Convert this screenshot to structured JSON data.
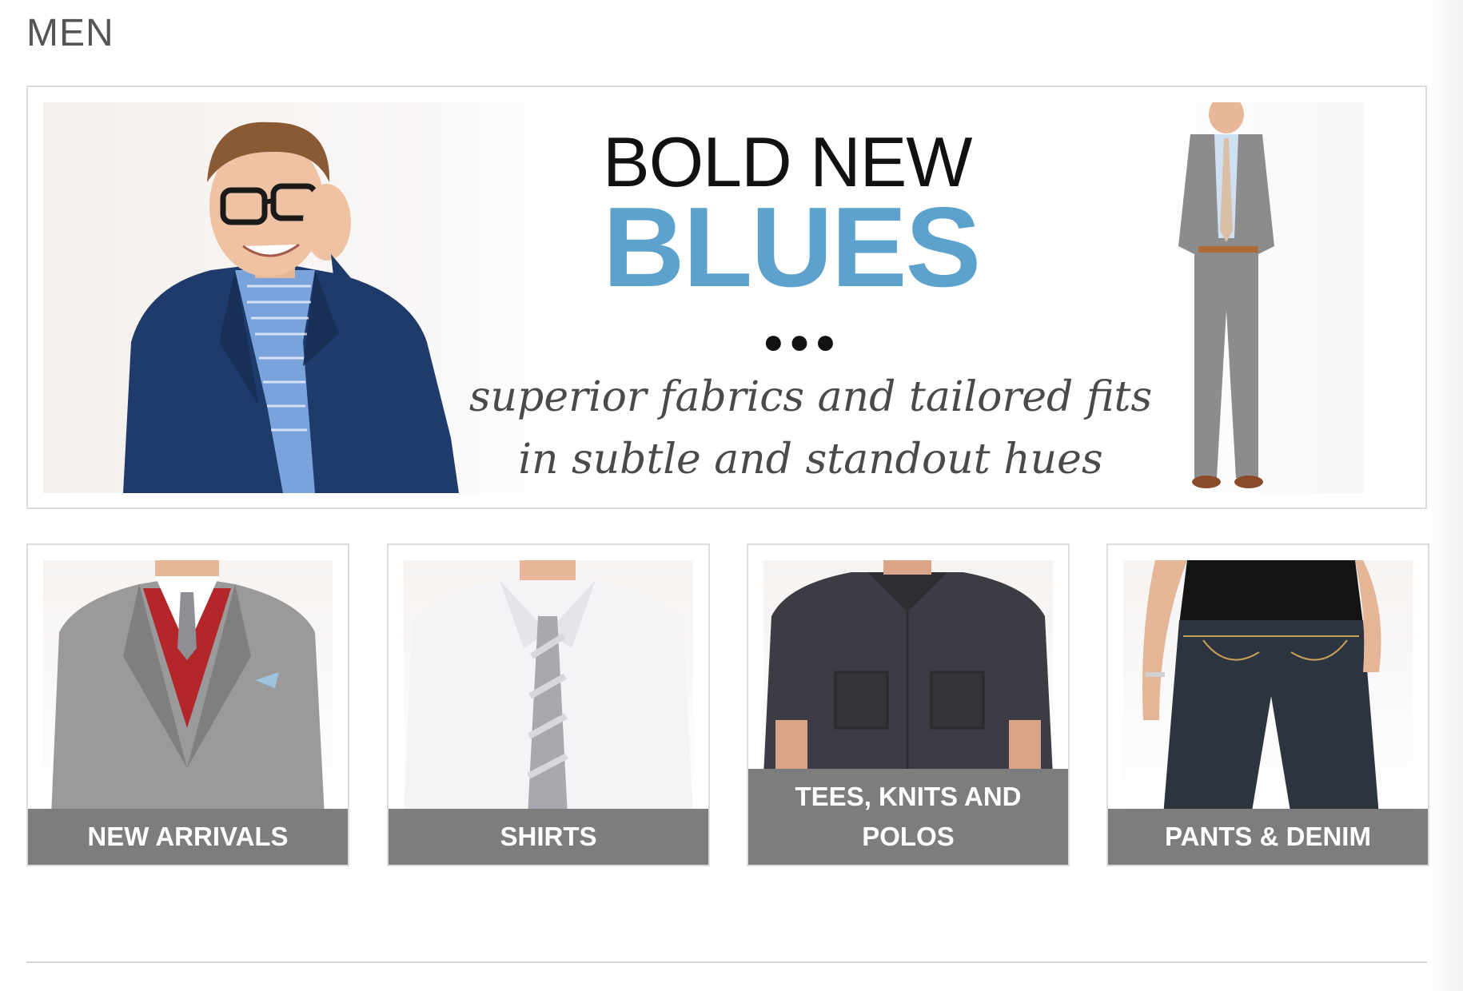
{
  "page": {
    "title": "MEN"
  },
  "hero": {
    "headline_line1": "BOLD NEW",
    "headline_line2": "BLUES",
    "dots": "●●●",
    "tagline_line1": "superior fabrics and tailored fits",
    "tagline_line2": "in subtle and standout hues",
    "colors": {
      "accent": "#5da2cc",
      "tagline": "#4a4a4a"
    }
  },
  "categories": [
    {
      "label": "NEW ARRIVALS"
    },
    {
      "label": "SHIRTS"
    },
    {
      "label": "TEES, KNITS AND POLOS"
    },
    {
      "label": "PANTS & DENIM"
    }
  ],
  "colors": {
    "label_bar": "#7d7d7d",
    "border": "#dcdcdc",
    "title": "#555555"
  }
}
